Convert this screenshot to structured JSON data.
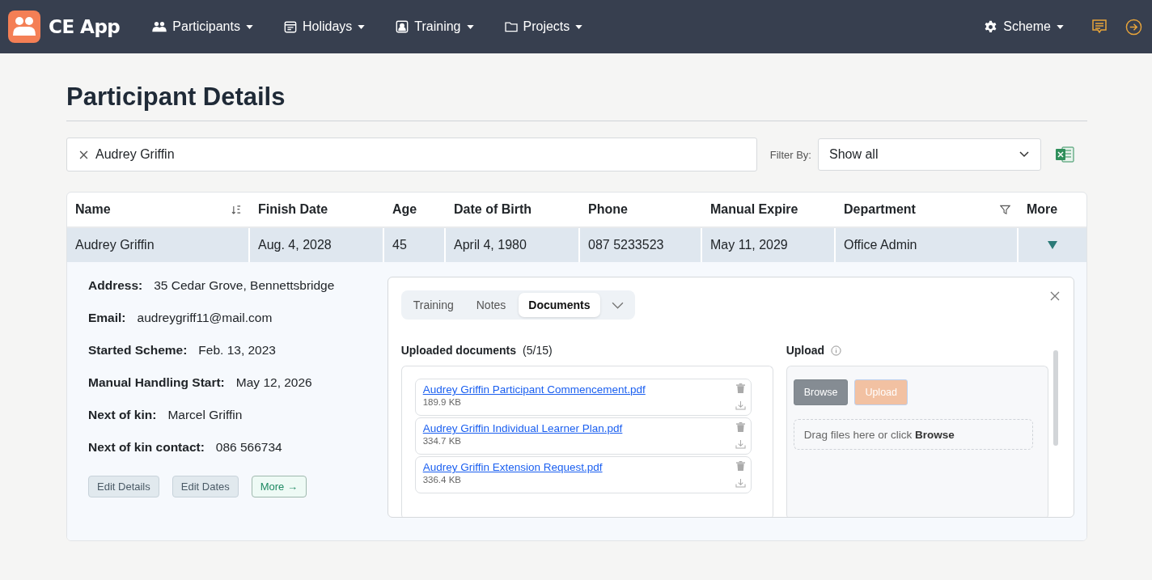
{
  "navbar": {
    "brand": "CE App",
    "menus": [
      {
        "label": "Participants"
      },
      {
        "label": "Holidays"
      },
      {
        "label": "Training"
      },
      {
        "label": "Projects"
      }
    ],
    "right_menu": {
      "label": "Scheme"
    }
  },
  "page_title": "Participant Details",
  "search": {
    "value": "Audrey Griffin"
  },
  "filter": {
    "label": "Filter By:",
    "value": "Show all"
  },
  "table": {
    "columns": [
      {
        "label": "Name",
        "kind": "sort"
      },
      {
        "label": "Finish Date",
        "kind": "plain"
      },
      {
        "label": "Age",
        "kind": "plain"
      },
      {
        "label": "Date of Birth",
        "kind": "plain"
      },
      {
        "label": "Phone",
        "kind": "plain"
      },
      {
        "label": "Manual Expire",
        "kind": "plain"
      },
      {
        "label": "Department",
        "kind": "filter"
      },
      {
        "label": "More",
        "kind": "plain"
      }
    ],
    "rows": [
      {
        "cells": [
          "Audrey Griffin",
          "Aug. 4, 2028",
          "45",
          "April 4, 1980",
          "087 5233523",
          "May 11, 2029",
          "Office Admin"
        ],
        "expanded": true
      }
    ]
  },
  "details": {
    "fields": [
      {
        "label": "Address:",
        "value": "35 Cedar Grove, Bennettsbridge"
      },
      {
        "label": "Email:",
        "value": "audreygriff11@mail.com"
      },
      {
        "label": "Started Scheme:",
        "value": "Feb. 13, 2023"
      },
      {
        "label": "Manual Handling Start:",
        "value": "May 12, 2026"
      },
      {
        "label": "Next of kin:",
        "value": "Marcel Griffin"
      },
      {
        "label": "Next of kin contact:",
        "value": "086 566734"
      }
    ],
    "buttons": [
      {
        "label": "Edit Details",
        "kind": "plain"
      },
      {
        "label": "Edit Dates",
        "kind": "plain"
      },
      {
        "label": "More →",
        "kind": "accent"
      }
    ]
  },
  "panel": {
    "tabs": [
      {
        "label": "Training",
        "selected": false
      },
      {
        "label": "Notes",
        "selected": false
      },
      {
        "label": "Documents",
        "selected": true
      }
    ],
    "documents": {
      "title": "Uploaded documents",
      "count": "(5/15)",
      "files": [
        {
          "name": "Audrey Griffin Participant Commencement.pdf",
          "size": "189.9 KB"
        },
        {
          "name": "Audrey Griffin Individual Learner Plan.pdf",
          "size": "334.7 KB"
        },
        {
          "name": "Audrey Griffin Extension Request.pdf",
          "size": "336.4 KB"
        }
      ]
    },
    "upload": {
      "title": "Upload",
      "buttons": [
        {
          "label": "Browse",
          "disabled": false
        },
        {
          "label": "Upload",
          "disabled": true
        }
      ],
      "drop_hint": "Drag files here or click **Browse**"
    }
  }
}
